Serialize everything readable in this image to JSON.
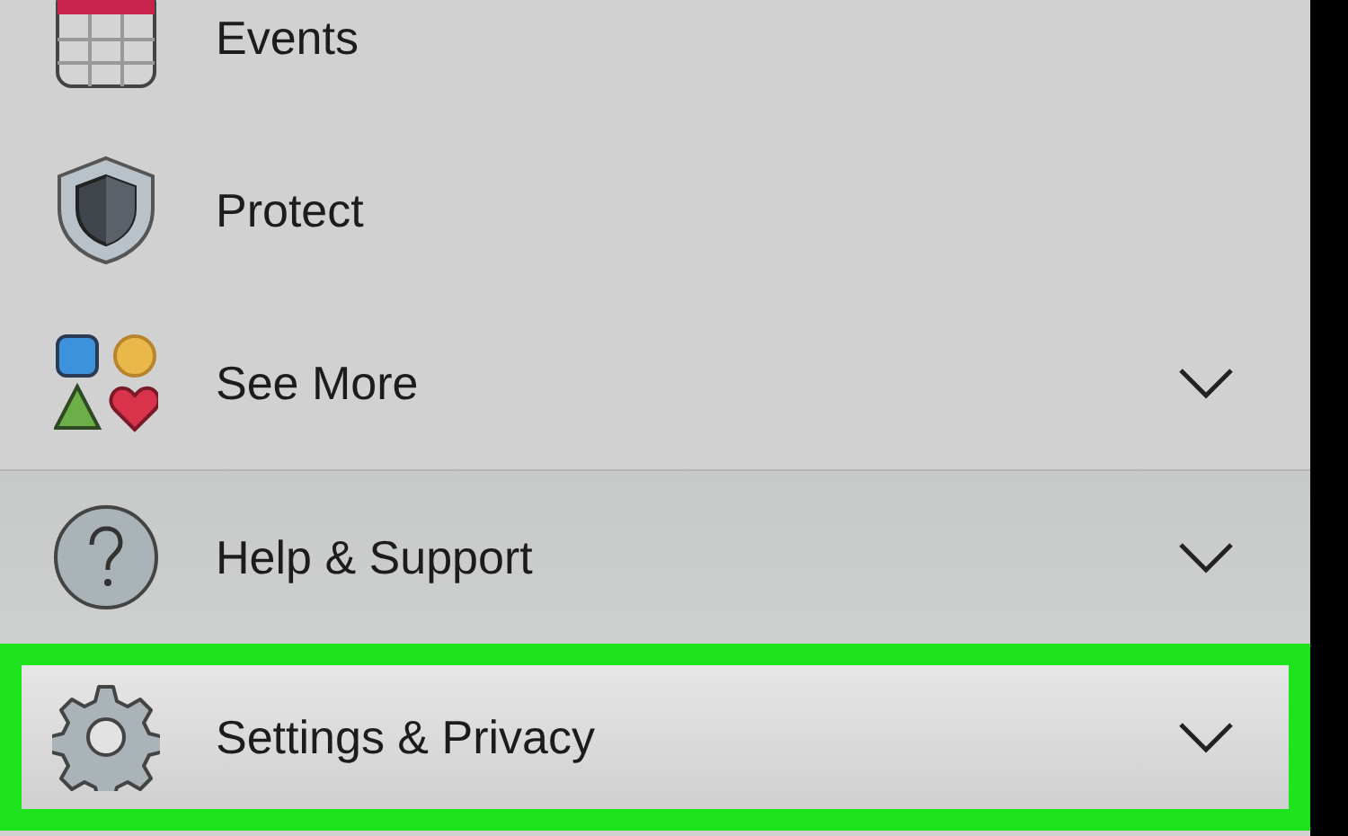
{
  "menu": {
    "sections": [
      {
        "items": [
          {
            "label": "Events",
            "kind": "calendar",
            "expandable": false,
            "highlighted": false
          },
          {
            "label": "Protect",
            "kind": "shield",
            "expandable": false,
            "highlighted": false
          },
          {
            "label": "See More",
            "kind": "shapes",
            "expandable": true,
            "highlighted": false
          }
        ]
      },
      {
        "items": [
          {
            "label": "Help & Support",
            "kind": "help",
            "expandable": true,
            "highlighted": false
          },
          {
            "label": "Settings & Privacy",
            "kind": "gear",
            "expandable": true,
            "highlighted": true
          }
        ]
      }
    ]
  }
}
